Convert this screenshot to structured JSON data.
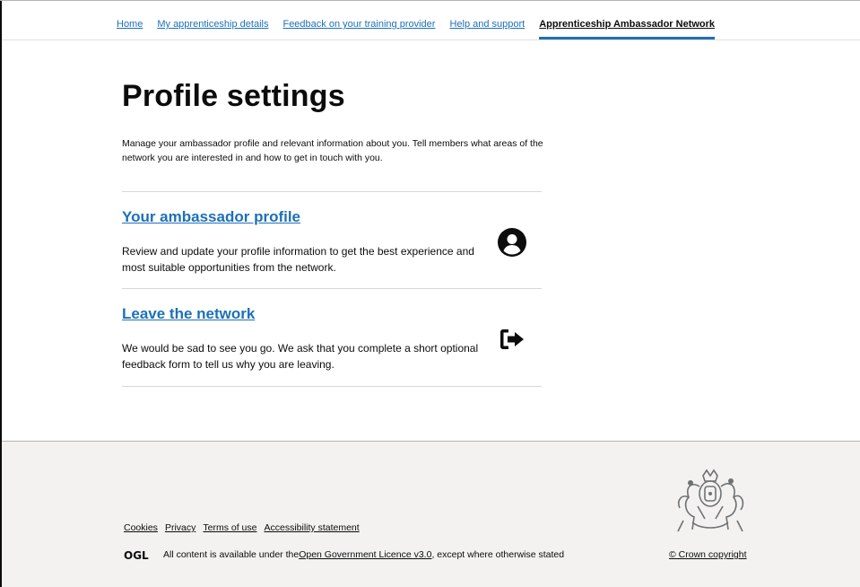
{
  "nav": {
    "items": [
      {
        "label": "Home"
      },
      {
        "label": "My apprenticeship details"
      },
      {
        "label": "Feedback on your training provider"
      },
      {
        "label": "Help and support"
      },
      {
        "label": "Apprenticeship Ambassador Network"
      }
    ],
    "active_index": 4
  },
  "main": {
    "title": "Profile settings",
    "intro": "Manage your ambassador profile and relevant information about you. Tell members what areas of the network you are interested in and how to get in touch with you.",
    "cards": [
      {
        "link": "Your ambassador profile",
        "description": "Review and update your profile information to get the best experience and most suitable opportunities from the network.",
        "icon": "user-circle-icon"
      },
      {
        "link": "Leave the network",
        "description": "We would be sad to see you go. We ask that you complete a short optional feedback form to tell us why you are leaving.",
        "icon": "sign-out-icon"
      }
    ]
  },
  "footer": {
    "links": [
      "Cookies",
      "Privacy",
      "Terms of use",
      "Accessibility statement"
    ],
    "licence_prefix": "All content is available under the ",
    "licence_link": "Open Government Licence v3.0",
    "licence_suffix": ", except where otherwise stated",
    "copyright": "© Crown copyright",
    "ogl_logo": "OGL"
  },
  "colors": {
    "link": "#1d70b8",
    "text": "#0b0c0c",
    "footer_bg": "#f3f2f1"
  }
}
